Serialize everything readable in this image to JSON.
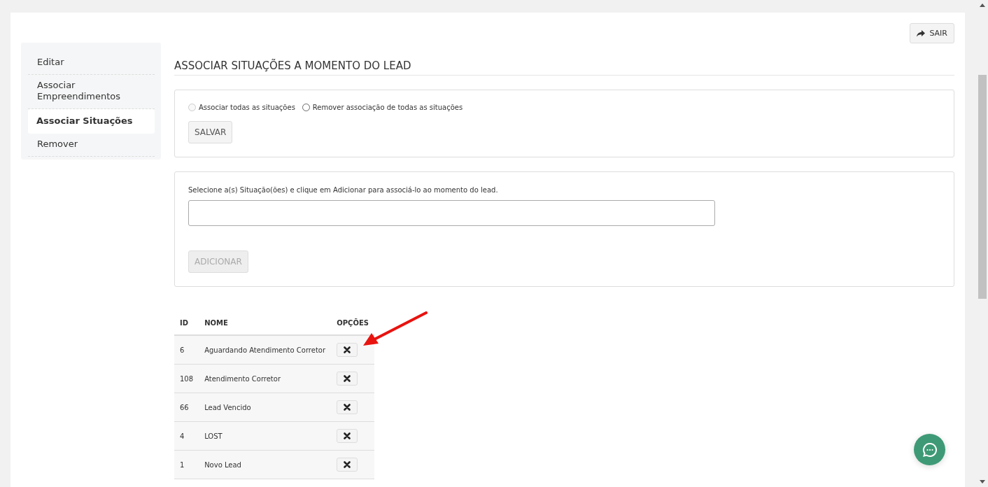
{
  "exit_button": {
    "label": "SAIR"
  },
  "sidebar": {
    "items": [
      {
        "label": "Editar",
        "selected": false
      },
      {
        "label": "Associar Empreendimentos",
        "selected": false
      },
      {
        "label": "Associar Situações",
        "selected": true
      },
      {
        "label": "Remover",
        "selected": false
      }
    ]
  },
  "page_title": "ASSOCIAR SITUAÇÕES A MOMENTO DO LEAD",
  "bulk_panel": {
    "options": [
      {
        "label": "Associar todas as situações",
        "selected": false,
        "disabled": true
      },
      {
        "label": "Remover associação de todas as situações",
        "selected": false,
        "disabled": false
      }
    ],
    "save_button": {
      "label": "SALVAR",
      "disabled": false
    }
  },
  "add_panel": {
    "instruction": "Selecione a(s) Situação(ões) e clique em Adicionar para associá-lo ao momento do lead.",
    "add_button": {
      "label": "ADICIONAR",
      "disabled": true
    }
  },
  "table": {
    "columns": [
      "ID",
      "NOME",
      "OPÇÕES"
    ],
    "rows": [
      {
        "id": "6",
        "name": "Aguardando Atendimento Corretor"
      },
      {
        "id": "108",
        "name": "Atendimento Corretor"
      },
      {
        "id": "66",
        "name": "Lead Vencido"
      },
      {
        "id": "4",
        "name": "LOST"
      },
      {
        "id": "1",
        "name": "Novo Lead"
      }
    ]
  }
}
